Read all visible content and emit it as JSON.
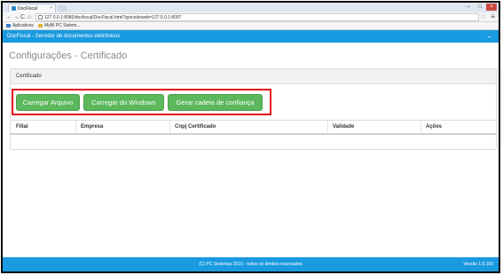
{
  "browser": {
    "tab_title": "DocFiscal",
    "tab_close": "×",
    "win_minimize": "–",
    "win_maximize": "□",
    "win_close": "×",
    "nav_back": "←",
    "nav_forward": "→",
    "nav_reload": "C",
    "nav_home": "⌂",
    "url": "127.0.0.1:8080/docfiscal/DocFiscal.html?getcodeweb=127.0.0.1:8097",
    "star": "☆",
    "menu": "≡",
    "bookmarks": [
      {
        "label": "Aplicativos",
        "color": "#3b7ed0"
      },
      {
        "label": "MyBI PC Sistem...",
        "color": "#e0b33a"
      }
    ]
  },
  "app": {
    "brand": "DocFiscal - Servidor de documentos eletrônicos",
    "back_icon": "←",
    "page_title": "Configurações - Certificado",
    "panel_title": "Certificado",
    "buttons": {
      "load_file": "Carregar Arquivo",
      "load_windows": "Carregar do Windows",
      "trust_chain": "Gerar cadeia de confiança"
    },
    "table": {
      "columns": [
        "Filial",
        "Empresa",
        "Cnpj Certificado",
        "Validade",
        "Ações"
      ],
      "rows": []
    },
    "footer": {
      "copyright": "(C) PC Sistemas 2015 - todos os direitos reservados",
      "version": "Versão 1.0.160"
    }
  },
  "colors": {
    "appbar": "#1a9ae0",
    "button": "#5cb85c",
    "highlight": "#e4131d"
  }
}
